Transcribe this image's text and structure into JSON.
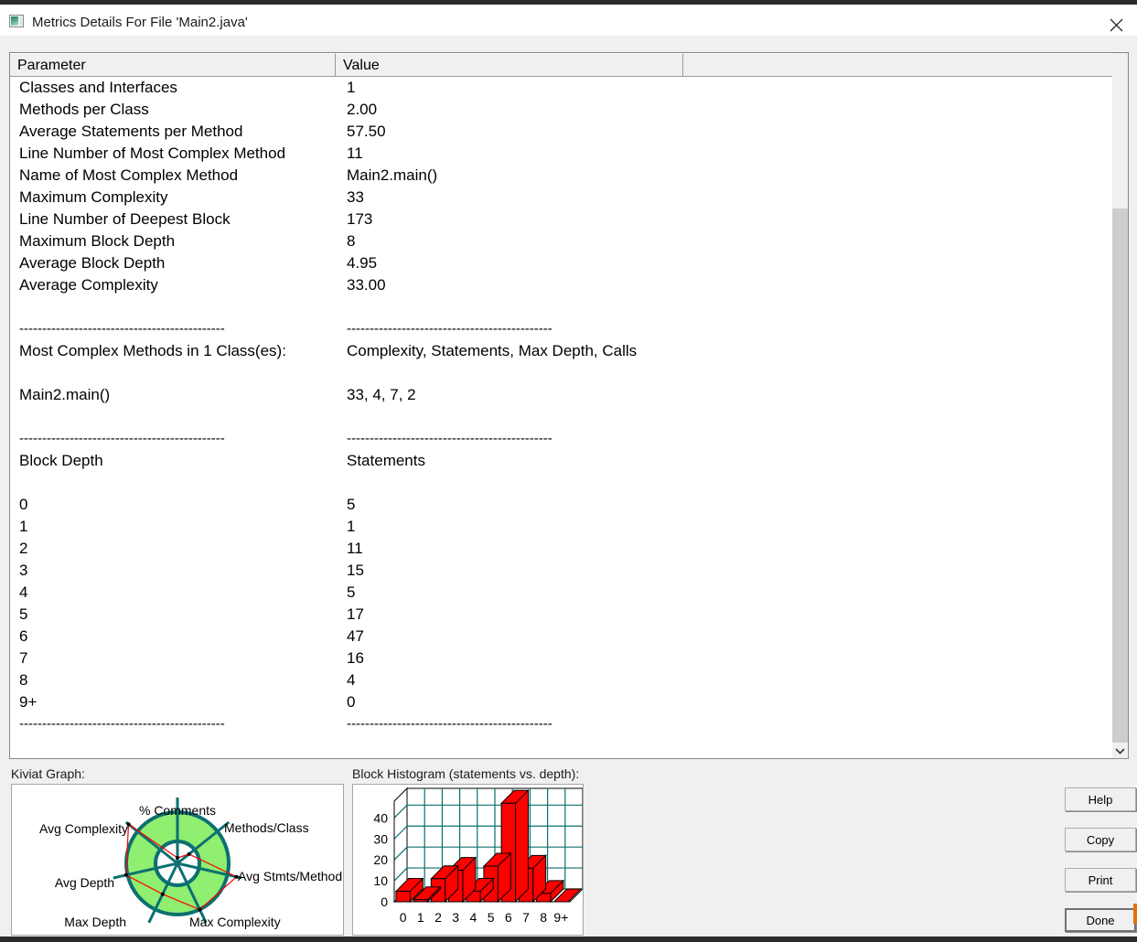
{
  "window": {
    "title": "Metrics Details For File 'Main2.java'",
    "icon": "image-metrics-icon",
    "close_icon": "close-icon"
  },
  "table": {
    "columns": [
      "Parameter",
      "Value",
      ""
    ],
    "rows": [
      {
        "param": "Classes and Interfaces",
        "value": "1"
      },
      {
        "param": "Methods per Class",
        "value": "2.00"
      },
      {
        "param": "Average Statements per Method",
        "value": "57.50"
      },
      {
        "param": "Line Number of Most Complex Method",
        "value": "11"
      },
      {
        "param": "Name of Most Complex Method",
        "value": "Main2.main()"
      },
      {
        "param": "Maximum Complexity",
        "value": "33"
      },
      {
        "param": "Line Number of Deepest Block",
        "value": "173"
      },
      {
        "param": "Maximum Block Depth",
        "value": "8"
      },
      {
        "param": "Average Block Depth",
        "value": "4.95"
      },
      {
        "param": "Average Complexity",
        "value": "33.00"
      },
      {
        "param": "",
        "value": ""
      },
      {
        "param": "---------------------------------------------",
        "value": "---------------------------------------------",
        "dash": true
      },
      {
        "param": "Most Complex Methods in 1 Class(es):",
        "value": "Complexity, Statements, Max Depth, Calls"
      },
      {
        "param": "",
        "value": ""
      },
      {
        "param": "Main2.main()",
        "value": "33, 4, 7, 2"
      },
      {
        "param": "",
        "value": ""
      },
      {
        "param": "---------------------------------------------",
        "value": "---------------------------------------------",
        "dash": true
      },
      {
        "param": "Block Depth",
        "value": "Statements"
      },
      {
        "param": "",
        "value": ""
      },
      {
        "param": "0",
        "value": "5"
      },
      {
        "param": "1",
        "value": "1"
      },
      {
        "param": "2",
        "value": "11"
      },
      {
        "param": "3",
        "value": "15"
      },
      {
        "param": "4",
        "value": "5"
      },
      {
        "param": "5",
        "value": "17"
      },
      {
        "param": "6",
        "value": "47"
      },
      {
        "param": "7",
        "value": "16"
      },
      {
        "param": "8",
        "value": "4"
      },
      {
        "param": "9+",
        "value": "0"
      },
      {
        "param": "---------------------------------------------",
        "value": "---------------------------------------------",
        "dash": true
      }
    ]
  },
  "panels": {
    "kiviat_label": "Kiviat Graph:",
    "histogram_label": "Block Histogram (statements vs. depth):"
  },
  "buttons": {
    "help": "Help",
    "copy": "Copy",
    "print": "Print",
    "done": "Done"
  },
  "colors": {
    "bar_fill": "#FF0000",
    "grid": "#0b7070",
    "kiviat_fill": "#90EE70",
    "kiviat_ring": "#0b7070",
    "kiviat_polygon": "#FF0000",
    "window_bg": "#F0F0F0"
  },
  "chart_data": [
    {
      "type": "bar",
      "name": "block-histogram",
      "title": "Block Histogram (statements vs. depth):",
      "xlabel": "",
      "ylabel": "",
      "categories": [
        "0",
        "1",
        "2",
        "3",
        "4",
        "5",
        "6",
        "7",
        "8",
        "9+"
      ],
      "values": [
        5,
        1,
        11,
        15,
        5,
        17,
        47,
        16,
        4,
        0
      ],
      "ylim": [
        0,
        48
      ],
      "yticks": [
        0,
        10,
        20,
        30,
        40
      ],
      "grid": true,
      "legend": "none",
      "style": "3d"
    },
    {
      "type": "radar",
      "name": "kiviat-graph",
      "title": "Kiviat Graph:",
      "axes": [
        "% Comments",
        "Methods/Class",
        "Avg Stmts/Method",
        "Max Complexity",
        "Max Depth",
        "Avg Depth",
        "Avg Complexity"
      ],
      "values": [
        0.08,
        0.2,
        0.92,
        0.78,
        0.52,
        0.8,
        0.95
      ],
      "ylim": [
        0,
        1
      ],
      "band_inner": 0.22,
      "band_outer": 0.52,
      "grid": true,
      "legend": "none"
    }
  ]
}
